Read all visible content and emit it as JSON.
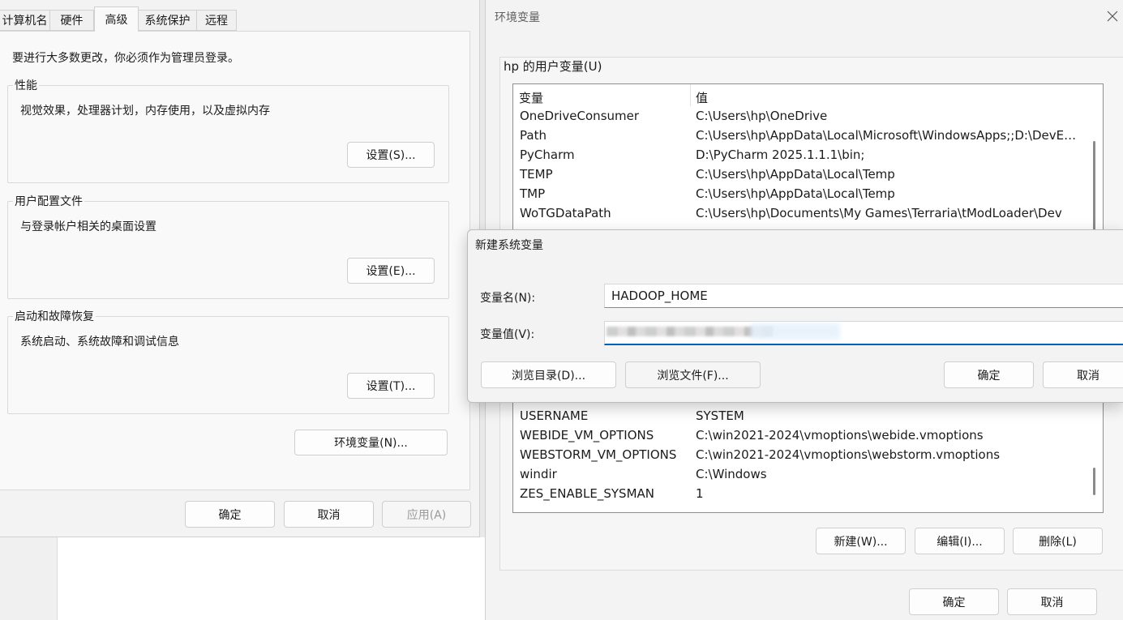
{
  "system_properties": {
    "tabs": [
      "计算机名",
      "硬件",
      "高级",
      "系统保护",
      "远程"
    ],
    "admin_notice": "要进行大多数更改，你必须作为管理员登录。",
    "performance": {
      "title": "性能",
      "desc": "视觉效果，处理器计划，内存使用，以及虚拟内存",
      "button": "设置(S)..."
    },
    "user_profiles": {
      "title": "用户配置文件",
      "desc": "与登录帐户相关的桌面设置",
      "button": "设置(E)..."
    },
    "startup_recovery": {
      "title": "启动和故障恢复",
      "desc": "系统启动、系统故障和调试信息",
      "button": "设置(T)..."
    },
    "env_button": "环境变量(N)...",
    "ok": "确定",
    "cancel": "取消",
    "apply": "应用(A)"
  },
  "env_dialog": {
    "title": "环境变量",
    "user_section": "hp 的用户变量(U)",
    "columns": [
      "变量",
      "值"
    ],
    "user_vars": [
      {
        "name": "OneDriveConsumer",
        "value": "C:\\Users\\hp\\OneDrive"
      },
      {
        "name": "Path",
        "value": "C:\\Users\\hp\\AppData\\Local\\Microsoft\\WindowsApps;;D:\\DevEc..."
      },
      {
        "name": "PyCharm",
        "value": "D:\\PyCharm 2025.1.1.1\\bin;"
      },
      {
        "name": "TEMP",
        "value": "C:\\Users\\hp\\AppData\\Local\\Temp"
      },
      {
        "name": "TMP",
        "value": "C:\\Users\\hp\\AppData\\Local\\Temp"
      },
      {
        "name": "WoTGDataPath",
        "value": "C:\\Users\\hp\\Documents\\My Games\\Terraria\\tModLoader\\Dev"
      }
    ],
    "system_vars": [
      {
        "name": "USERNAME",
        "value": "SYSTEM"
      },
      {
        "name": "WEBIDE_VM_OPTIONS",
        "value": "C:\\win2021-2024\\vmoptions\\webide.vmoptions"
      },
      {
        "name": "WEBSTORM_VM_OPTIONS",
        "value": "C:\\win2021-2024\\vmoptions\\webstorm.vmoptions"
      },
      {
        "name": "windir",
        "value": "C:\\Windows"
      },
      {
        "name": "ZES_ENABLE_SYSMAN",
        "value": "1"
      }
    ],
    "new_button": "新建(W)...",
    "edit_button": "编辑(I)...",
    "delete_button": "删除(L)",
    "ok": "确定",
    "cancel": "取消"
  },
  "new_var_dialog": {
    "title": "新建系统变量",
    "name_label": "变量名(N):",
    "value_label": "变量值(V):",
    "name_value": "HADOOP_HOME",
    "value_value": "",
    "browse_dir": "浏览目录(D)...",
    "browse_file": "浏览文件(F)...",
    "ok": "确定",
    "cancel": "取消"
  },
  "colors": {
    "accent": "#005fb8",
    "window_bg": "#f3f3f3",
    "panel_bg": "#f9f9f9"
  }
}
